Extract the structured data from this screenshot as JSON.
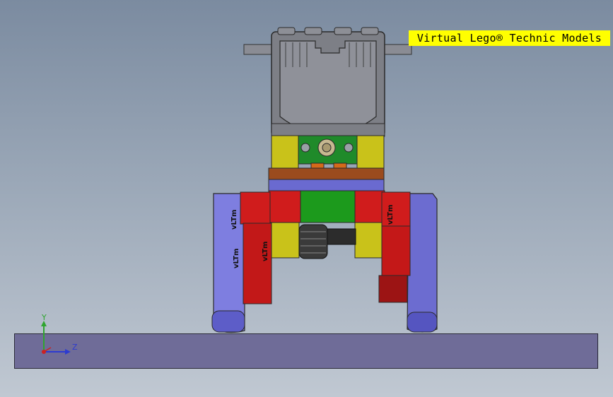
{
  "banner": {
    "text": "Virtual Lego® Technic Models"
  },
  "axes": {
    "y_label": "Y",
    "z_label": "Z"
  },
  "parts": {
    "left_leg_text_1": "vLTm",
    "left_leg_text_2": "vLTm",
    "left_leg_text_3": "vLTm",
    "right_leg_text_1": "vLTm"
  },
  "colors": {
    "background_top": "#7b8ba0",
    "background_bottom": "#c0c8d2",
    "banner": "#ffff00",
    "ground": "#6f6c98",
    "leg_blue": "#7e7ee0",
    "red": "#d01c1c",
    "yellow": "#c9c21a",
    "green": "#1c9a1c",
    "gray": "#7d7f86",
    "brown": "#9b4b1e"
  }
}
